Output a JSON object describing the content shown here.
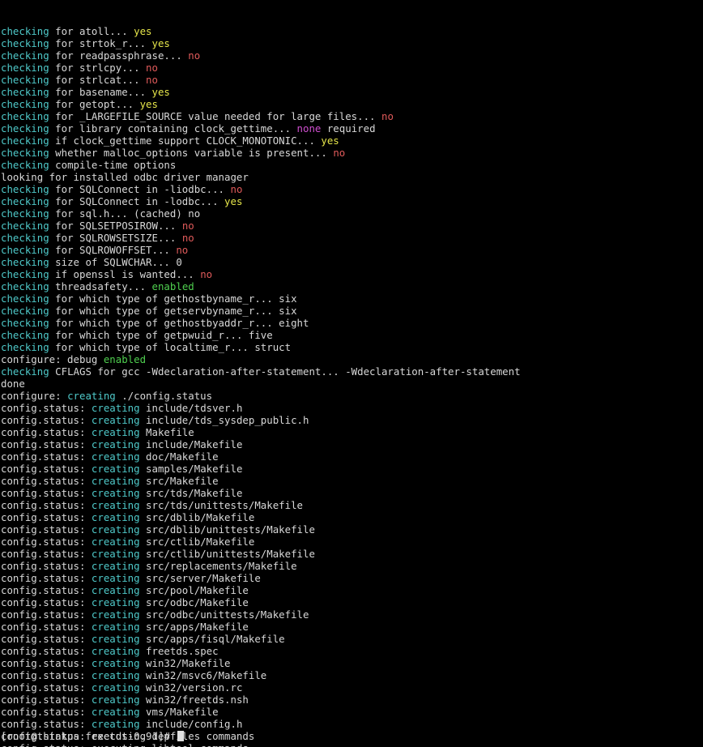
{
  "colors": {
    "background": "#000000",
    "default": "#d8d8d8",
    "cyan": "#4fc9c9",
    "yellow": "#e5e54a",
    "red": "#e05a5a",
    "magenta": "#d04fd0",
    "green": "#4fd04f"
  },
  "terminal": {
    "prompt": "[root@thinkpa freetds-0.91]# ",
    "lines": [
      [
        [
          "cyan",
          "checking"
        ],
        [
          "default",
          " for atoll... "
        ],
        [
          "yellow",
          "yes"
        ]
      ],
      [
        [
          "cyan",
          "checking"
        ],
        [
          "default",
          " for strtok_r... "
        ],
        [
          "yellow",
          "yes"
        ]
      ],
      [
        [
          "cyan",
          "checking"
        ],
        [
          "default",
          " for readpassphrase... "
        ],
        [
          "red",
          "no"
        ]
      ],
      [
        [
          "cyan",
          "checking"
        ],
        [
          "default",
          " for strlcpy... "
        ],
        [
          "red",
          "no"
        ]
      ],
      [
        [
          "cyan",
          "checking"
        ],
        [
          "default",
          " for strlcat... "
        ],
        [
          "red",
          "no"
        ]
      ],
      [
        [
          "cyan",
          "checking"
        ],
        [
          "default",
          " for basename... "
        ],
        [
          "yellow",
          "yes"
        ]
      ],
      [
        [
          "cyan",
          "checking"
        ],
        [
          "default",
          " for getopt... "
        ],
        [
          "yellow",
          "yes"
        ]
      ],
      [
        [
          "cyan",
          "checking"
        ],
        [
          "default",
          " for _LARGEFILE_SOURCE value needed for large files... "
        ],
        [
          "red",
          "no"
        ]
      ],
      [
        [
          "cyan",
          "checking"
        ],
        [
          "default",
          " for library containing clock_gettime... "
        ],
        [
          "magenta",
          "none"
        ],
        [
          "default",
          " required"
        ]
      ],
      [
        [
          "cyan",
          "checking"
        ],
        [
          "default",
          " if clock_gettime support CLOCK_MONOTONIC... "
        ],
        [
          "yellow",
          "yes"
        ]
      ],
      [
        [
          "cyan",
          "checking"
        ],
        [
          "default",
          " whether malloc_options variable is present... "
        ],
        [
          "red",
          "no"
        ]
      ],
      [
        [
          "cyan",
          "checking"
        ],
        [
          "default",
          " compile-time options"
        ]
      ],
      [
        [
          "default",
          "looking for installed odbc driver manager"
        ]
      ],
      [
        [
          "cyan",
          "checking"
        ],
        [
          "default",
          " for SQLConnect in -liodbc... "
        ],
        [
          "red",
          "no"
        ]
      ],
      [
        [
          "cyan",
          "checking"
        ],
        [
          "default",
          " for SQLConnect in -lodbc... "
        ],
        [
          "yellow",
          "yes"
        ]
      ],
      [
        [
          "cyan",
          "checking"
        ],
        [
          "default",
          " for sql.h... (cached) no"
        ]
      ],
      [
        [
          "cyan",
          "checking"
        ],
        [
          "default",
          " for SQLSETPOSIROW... "
        ],
        [
          "red",
          "no"
        ]
      ],
      [
        [
          "cyan",
          "checking"
        ],
        [
          "default",
          " for SQLROWSETSIZE... "
        ],
        [
          "red",
          "no"
        ]
      ],
      [
        [
          "cyan",
          "checking"
        ],
        [
          "default",
          " for SQLROWOFFSET... "
        ],
        [
          "red",
          "no"
        ]
      ],
      [
        [
          "cyan",
          "checking"
        ],
        [
          "default",
          " size of SQLWCHAR... 0"
        ]
      ],
      [
        [
          "cyan",
          "checking"
        ],
        [
          "default",
          " if openssl is wanted... "
        ],
        [
          "red",
          "no"
        ]
      ],
      [
        [
          "cyan",
          "checking"
        ],
        [
          "default",
          " threadsafety... "
        ],
        [
          "green",
          "enabled"
        ]
      ],
      [
        [
          "cyan",
          "checking"
        ],
        [
          "default",
          " for which type of gethostbyname_r... six"
        ]
      ],
      [
        [
          "cyan",
          "checking"
        ],
        [
          "default",
          " for which type of getservbyname_r... six"
        ]
      ],
      [
        [
          "cyan",
          "checking"
        ],
        [
          "default",
          " for which type of gethostbyaddr_r... eight"
        ]
      ],
      [
        [
          "cyan",
          "checking"
        ],
        [
          "default",
          " for which type of getpwuid_r... five"
        ]
      ],
      [
        [
          "cyan",
          "checking"
        ],
        [
          "default",
          " for which type of localtime_r... struct"
        ]
      ],
      [
        [
          "default",
          "configure: debug "
        ],
        [
          "green",
          "enabled"
        ]
      ],
      [
        [
          "cyan",
          "checking"
        ],
        [
          "default",
          " CFLAGS for gcc -Wdeclaration-after-statement... -Wdeclaration-after-statement"
        ]
      ],
      [
        [
          "default",
          "done"
        ]
      ],
      [
        [
          "default",
          "configure: "
        ],
        [
          "cyan",
          "creating"
        ],
        [
          "default",
          " ./config.status"
        ]
      ],
      [
        [
          "default",
          "config.status: "
        ],
        [
          "cyan",
          "creating"
        ],
        [
          "default",
          " include/tdsver.h"
        ]
      ],
      [
        [
          "default",
          "config.status: "
        ],
        [
          "cyan",
          "creating"
        ],
        [
          "default",
          " include/tds_sysdep_public.h"
        ]
      ],
      [
        [
          "default",
          "config.status: "
        ],
        [
          "cyan",
          "creating"
        ],
        [
          "default",
          " Makefile"
        ]
      ],
      [
        [
          "default",
          "config.status: "
        ],
        [
          "cyan",
          "creating"
        ],
        [
          "default",
          " include/Makefile"
        ]
      ],
      [
        [
          "default",
          "config.status: "
        ],
        [
          "cyan",
          "creating"
        ],
        [
          "default",
          " doc/Makefile"
        ]
      ],
      [
        [
          "default",
          "config.status: "
        ],
        [
          "cyan",
          "creating"
        ],
        [
          "default",
          " samples/Makefile"
        ]
      ],
      [
        [
          "default",
          "config.status: "
        ],
        [
          "cyan",
          "creating"
        ],
        [
          "default",
          " src/Makefile"
        ]
      ],
      [
        [
          "default",
          "config.status: "
        ],
        [
          "cyan",
          "creating"
        ],
        [
          "default",
          " src/tds/Makefile"
        ]
      ],
      [
        [
          "default",
          "config.status: "
        ],
        [
          "cyan",
          "creating"
        ],
        [
          "default",
          " src/tds/unittests/Makefile"
        ]
      ],
      [
        [
          "default",
          "config.status: "
        ],
        [
          "cyan",
          "creating"
        ],
        [
          "default",
          " src/dblib/Makefile"
        ]
      ],
      [
        [
          "default",
          "config.status: "
        ],
        [
          "cyan",
          "creating"
        ],
        [
          "default",
          " src/dblib/unittests/Makefile"
        ]
      ],
      [
        [
          "default",
          "config.status: "
        ],
        [
          "cyan",
          "creating"
        ],
        [
          "default",
          " src/ctlib/Makefile"
        ]
      ],
      [
        [
          "default",
          "config.status: "
        ],
        [
          "cyan",
          "creating"
        ],
        [
          "default",
          " src/ctlib/unittests/Makefile"
        ]
      ],
      [
        [
          "default",
          "config.status: "
        ],
        [
          "cyan",
          "creating"
        ],
        [
          "default",
          " src/replacements/Makefile"
        ]
      ],
      [
        [
          "default",
          "config.status: "
        ],
        [
          "cyan",
          "creating"
        ],
        [
          "default",
          " src/server/Makefile"
        ]
      ],
      [
        [
          "default",
          "config.status: "
        ],
        [
          "cyan",
          "creating"
        ],
        [
          "default",
          " src/pool/Makefile"
        ]
      ],
      [
        [
          "default",
          "config.status: "
        ],
        [
          "cyan",
          "creating"
        ],
        [
          "default",
          " src/odbc/Makefile"
        ]
      ],
      [
        [
          "default",
          "config.status: "
        ],
        [
          "cyan",
          "creating"
        ],
        [
          "default",
          " src/odbc/unittests/Makefile"
        ]
      ],
      [
        [
          "default",
          "config.status: "
        ],
        [
          "cyan",
          "creating"
        ],
        [
          "default",
          " src/apps/Makefile"
        ]
      ],
      [
        [
          "default",
          "config.status: "
        ],
        [
          "cyan",
          "creating"
        ],
        [
          "default",
          " src/apps/fisql/Makefile"
        ]
      ],
      [
        [
          "default",
          "config.status: "
        ],
        [
          "cyan",
          "creating"
        ],
        [
          "default",
          " freetds.spec"
        ]
      ],
      [
        [
          "default",
          "config.status: "
        ],
        [
          "cyan",
          "creating"
        ],
        [
          "default",
          " win32/Makefile"
        ]
      ],
      [
        [
          "default",
          "config.status: "
        ],
        [
          "cyan",
          "creating"
        ],
        [
          "default",
          " win32/msvc6/Makefile"
        ]
      ],
      [
        [
          "default",
          "config.status: "
        ],
        [
          "cyan",
          "creating"
        ],
        [
          "default",
          " win32/version.rc"
        ]
      ],
      [
        [
          "default",
          "config.status: "
        ],
        [
          "cyan",
          "creating"
        ],
        [
          "default",
          " win32/freetds.nsh"
        ]
      ],
      [
        [
          "default",
          "config.status: "
        ],
        [
          "cyan",
          "creating"
        ],
        [
          "default",
          " vms/Makefile"
        ]
      ],
      [
        [
          "default",
          "config.status: "
        ],
        [
          "cyan",
          "creating"
        ],
        [
          "default",
          " include/config.h"
        ]
      ],
      [
        [
          "default",
          "config.status: executing depfiles commands"
        ]
      ],
      [
        [
          "default",
          "config.status: executing libtool commands"
        ]
      ]
    ]
  }
}
